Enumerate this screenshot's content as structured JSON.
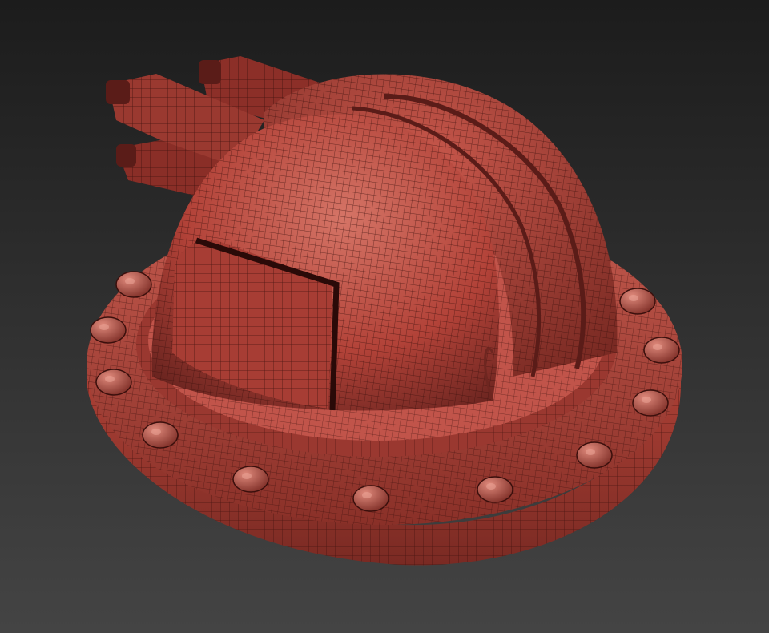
{
  "viewport": {
    "background_top": "#1c1c1c",
    "background_bottom": "#444444"
  },
  "model": {
    "subject": "turret-dome-wireframe",
    "colors": {
      "surface": "#b9463d",
      "surface_light": "#d06a5e",
      "surface_dark": "#6e2620",
      "wire": "#3a0f0c"
    },
    "bolt_count": 13
  }
}
